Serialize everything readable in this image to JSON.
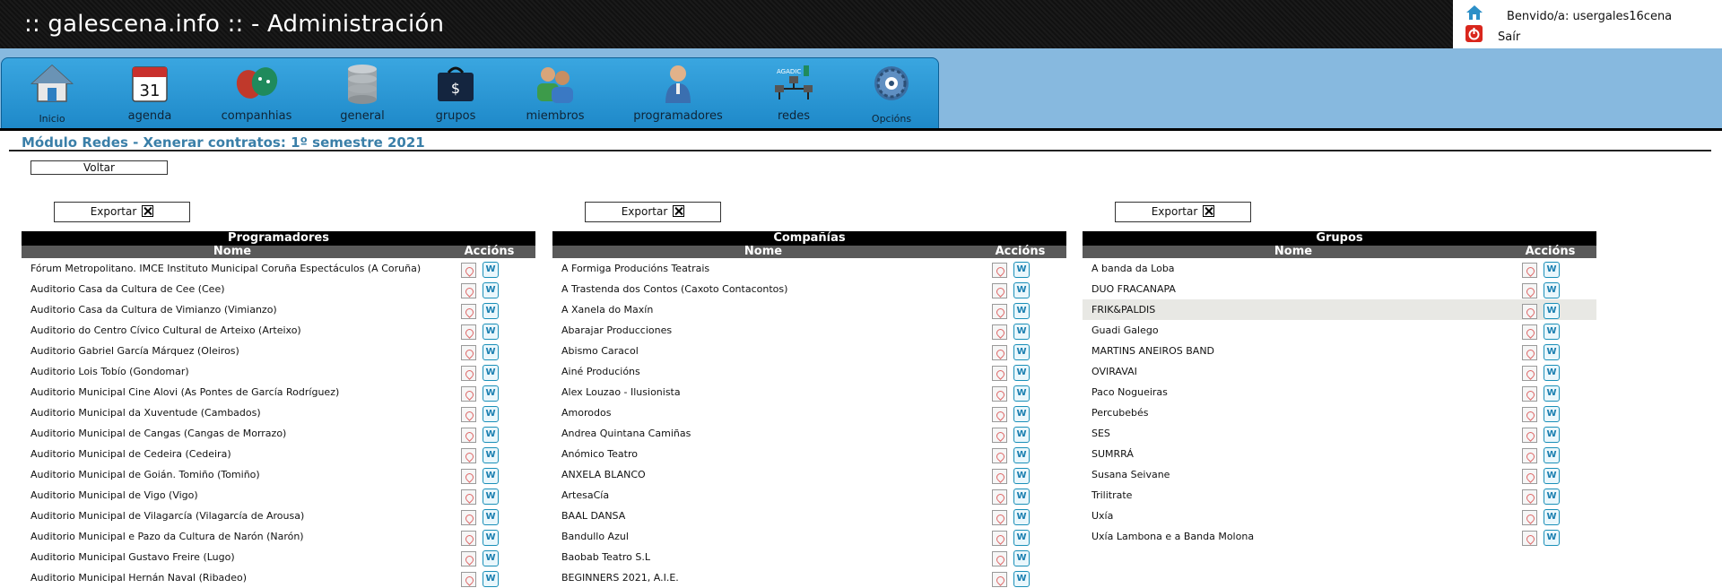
{
  "header": {
    "title": ":: galescena.info :: - Administración",
    "welcome": "Benvido/a: usergales16cena",
    "logout": "Saír"
  },
  "nav": [
    {
      "label": "Inicio",
      "icon": "home-icon",
      "small": true
    },
    {
      "label": "agenda",
      "icon": "calendar-icon",
      "day": "31"
    },
    {
      "label": "companhias",
      "icon": "masks-icon"
    },
    {
      "label": "general",
      "icon": "database-icon"
    },
    {
      "label": "grupos",
      "icon": "bag-icon"
    },
    {
      "label": "miembros",
      "icon": "members-icon"
    },
    {
      "label": "programadores",
      "icon": "person-icon"
    },
    {
      "label": "redes",
      "icon": "network-icon",
      "tag": "AGADIC"
    },
    {
      "label": "Opcións",
      "icon": "options-icon",
      "small": true
    }
  ],
  "page": {
    "title": "Módulo Redes - Xenerar contratos: 1º semestre 2021",
    "back": "Voltar",
    "export": "Exportar"
  },
  "columns": {
    "name": "Nome",
    "actions": "Accións"
  },
  "tables": [
    {
      "caption": "Programadores",
      "rows": [
        "Fórum Metropolitano. IMCE Instituto Municipal Coruña Espectáculos (A Coruña)",
        "Auditorio Casa da Cultura de Cee (Cee)",
        "Auditorio Casa da Cultura de Vimianzo (Vimianzo)",
        "Auditorio do Centro Cívico Cultural de Arteixo (Arteixo)",
        "Auditorio Gabriel García Márquez (Oleiros)",
        "Auditorio Lois Tobío (Gondomar)",
        "Auditorio Municipal Cine Alovi (As Pontes de García Rodríguez)",
        "Auditorio Municipal da Xuventude (Cambados)",
        "Auditorio Municipal de Cangas (Cangas de Morrazo)",
        "Auditorio Municipal de Cedeira (Cedeira)",
        "Auditorio Municipal de Goián. Tomiño (Tomiño)",
        "Auditorio Municipal de Vigo (Vigo)",
        "Auditorio Municipal de Vilagarcía (Vilagarcía de Arousa)",
        "Auditorio Municipal e Pazo da Cultura de Narón (Narón)",
        "Auditorio Municipal Gustavo Freire (Lugo)",
        "Auditorio Municipal Hernán Naval (Ribadeo)"
      ]
    },
    {
      "caption": "Compañías",
      "rows": [
        "A Formiga Producións Teatrais",
        "A Trastenda dos Contos (Caxoto Contacontos)",
        "A Xanela do Maxín",
        "Abarajar Producciones",
        "Abismo Caracol",
        "Ainé Producións",
        "Alex Louzao - Ilusionista",
        "Amorodos",
        "Andrea Quintana Camiñas",
        "Anómico Teatro",
        "ANXELA BLANCO",
        "ArtesaCía",
        "BAAL DANSA",
        "Bandullo Azul",
        "Baobab Teatro S.L",
        "BEGINNERS 2021, A.I.E."
      ]
    },
    {
      "caption": "Grupos",
      "rows": [
        "A banda da Loba",
        "DUO FRACANAPA",
        "FRIK&PALDIS",
        "Guadi Galego",
        "MARTINS ANEIROS BAND",
        "OVIRAVAI",
        "Paco Nogueiras",
        "Percubebés",
        "SES",
        "SUMRRÁ",
        "Susana Seivane",
        "Trilitrate",
        "Uxía",
        "Uxía Lambona e a Banda Molona"
      ],
      "highlight_row": 2
    }
  ],
  "colors": {
    "nav_bar": "#1e89c9",
    "nav_strip": "#87b9df",
    "title": "#3a7fa8"
  }
}
